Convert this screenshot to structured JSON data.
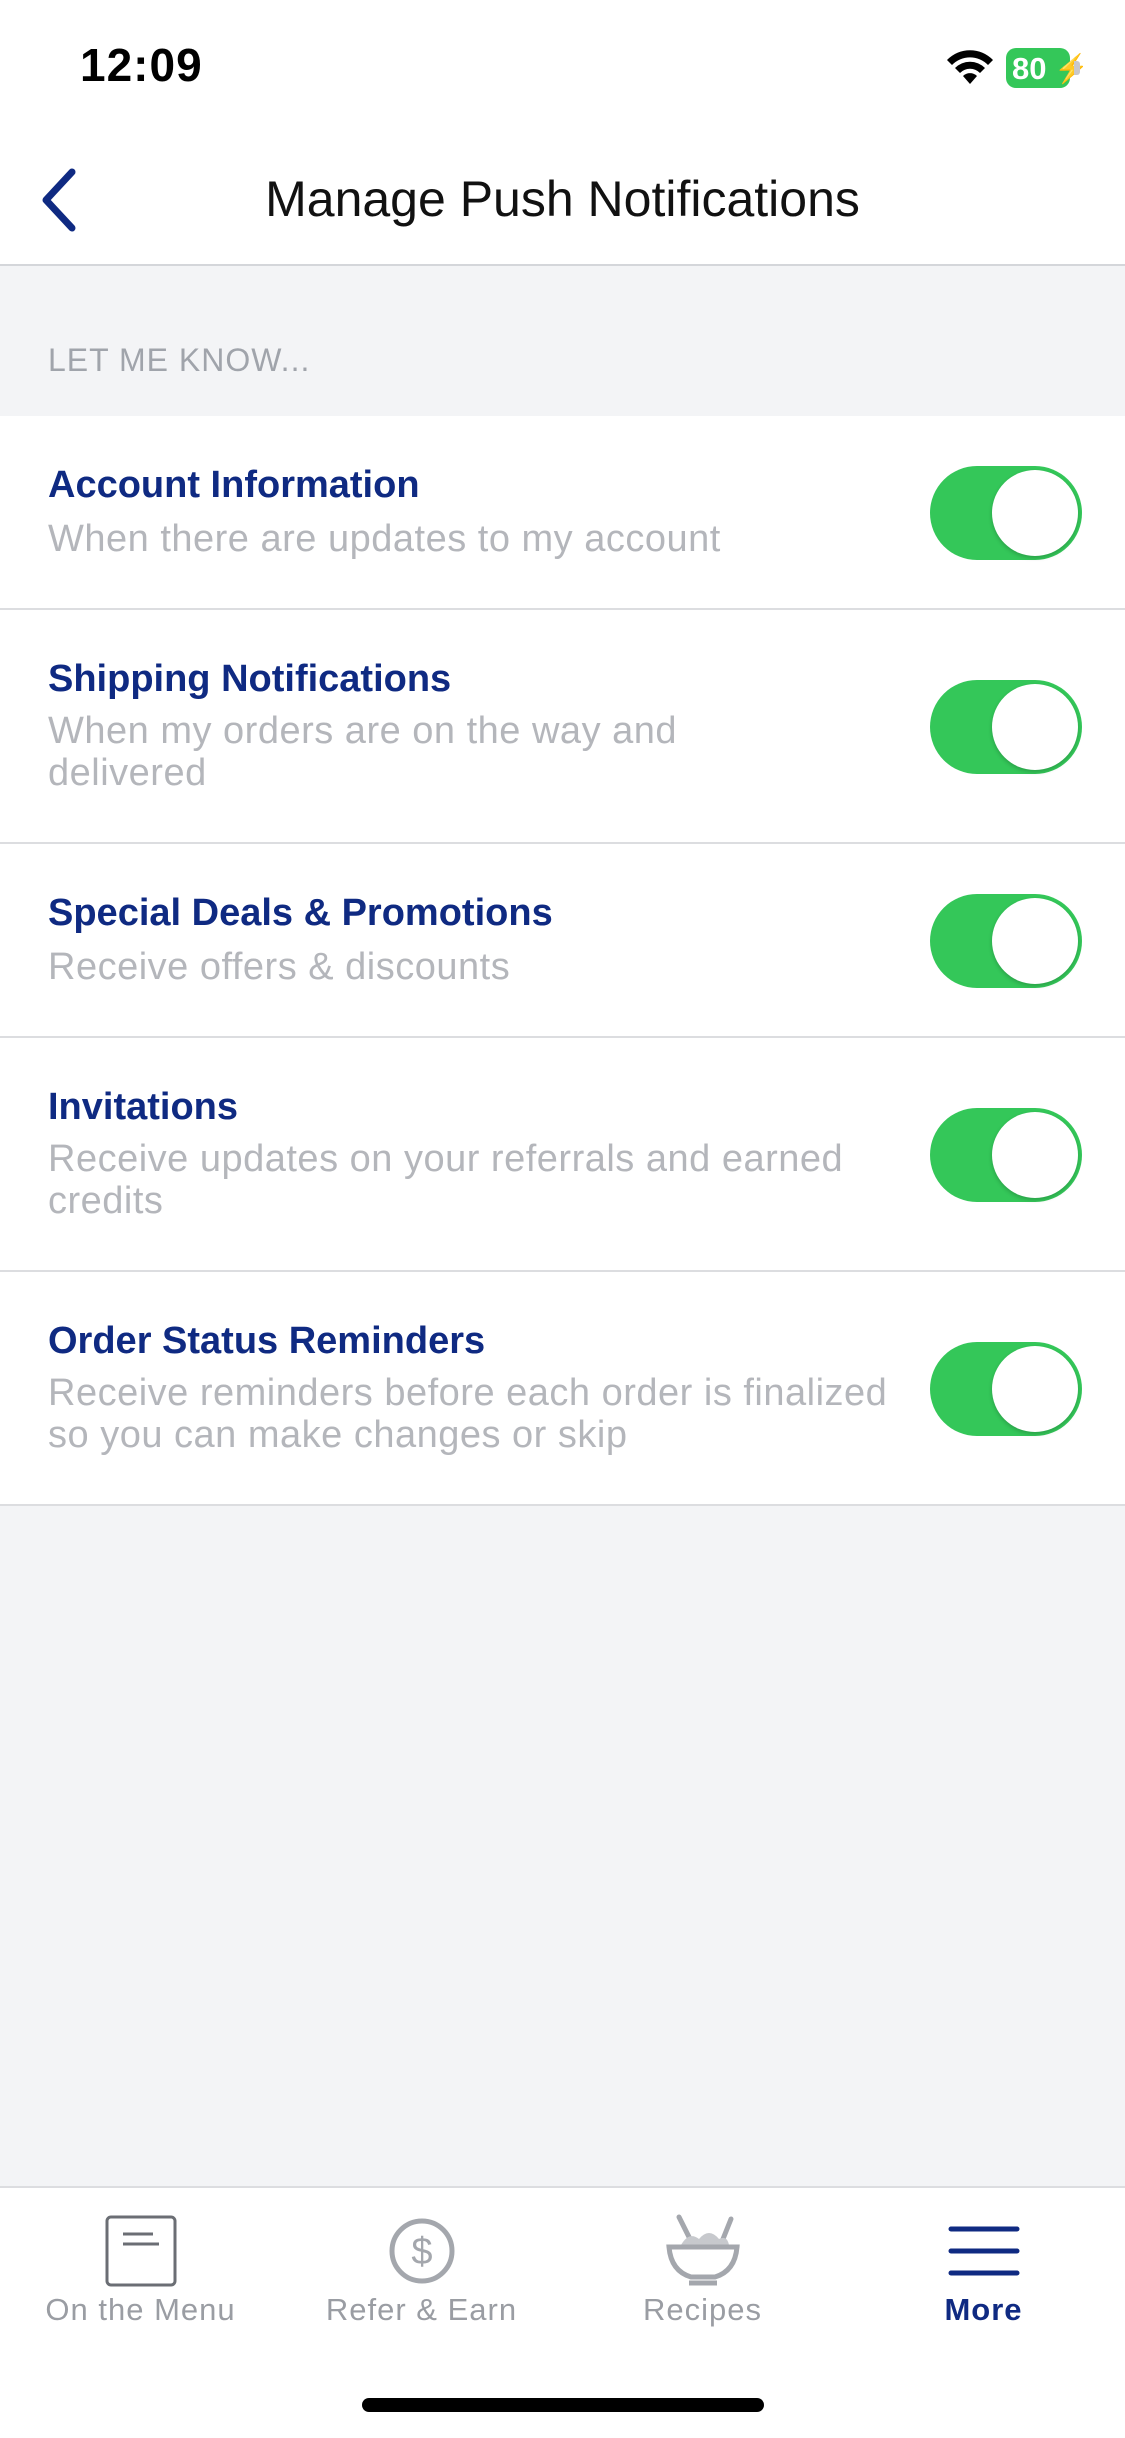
{
  "status_bar": {
    "time": "12:09",
    "battery": "80",
    "icons": [
      "wifi-icon",
      "battery-charging-icon"
    ]
  },
  "nav": {
    "title": "Manage Push Notifications",
    "back_icon": "chevron-left-icon"
  },
  "section": {
    "header": "LET ME KNOW..."
  },
  "settings": [
    {
      "title": "Account Information",
      "description": "When there are updates to my account",
      "enabled": true
    },
    {
      "title": "Shipping Notifications",
      "description": "When my orders are on the way and delivered",
      "enabled": true
    },
    {
      "title": "Special Deals & Promotions",
      "description": "Receive offers & discounts",
      "enabled": true
    },
    {
      "title": "Invitations",
      "description": "Receive updates on your referrals and earned credits",
      "enabled": true
    },
    {
      "title": "Order Status Reminders",
      "description": "Receive reminders before each order is finalized so you can make changes or skip",
      "enabled": true
    }
  ],
  "tab_bar": {
    "tabs": [
      {
        "label": "On the Menu",
        "icon": "menu-card-icon",
        "active": false
      },
      {
        "label": "Refer & Earn",
        "icon": "dollar-circle-icon",
        "active": false
      },
      {
        "label": "Recipes",
        "icon": "salad-bowl-icon",
        "active": false
      },
      {
        "label": "More",
        "icon": "hamburger-menu-icon",
        "active": true
      }
    ]
  },
  "colors": {
    "brand_navy": "#0f2a82",
    "toggle_on": "#34c759",
    "muted_text": "#b4b6bb",
    "background": "#f3f4f6"
  }
}
